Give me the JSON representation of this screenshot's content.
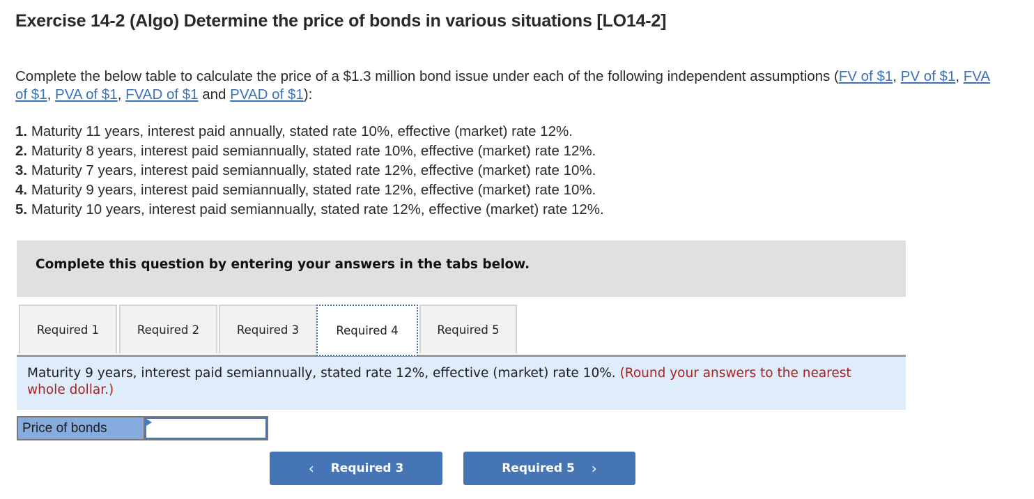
{
  "title": "Exercise 14-2 (Algo) Determine the price of bonds in various situations [LO14-2]",
  "intro": {
    "text_before": "Complete the below table to calculate the price of a $1.3 million bond issue under each of the following independent assumptions (",
    "links": [
      "FV of $1",
      "PV of $1",
      "FVA of $1",
      "PVA of $1",
      "FVAD of $1",
      "PVAD of $1"
    ],
    "separator": ", ",
    "conjunction": " and ",
    "text_after": "):"
  },
  "assumptions": [
    {
      "num": "1.",
      "text": "Maturity 11 years, interest paid annually, stated rate 10%, effective (market) rate 12%."
    },
    {
      "num": "2.",
      "text": "Maturity 8 years, interest paid semiannually, stated rate 10%, effective (market) rate 12%."
    },
    {
      "num": "3.",
      "text": "Maturity 7 years, interest paid semiannually, stated rate 12%, effective (market) rate 10%."
    },
    {
      "num": "4.",
      "text": "Maturity 9 years, interest paid semiannually, stated rate 12%, effective (market) rate 10%."
    },
    {
      "num": "5.",
      "text": "Maturity 10 years, interest paid semiannually, stated rate 12%, effective (market) rate 12%."
    }
  ],
  "instruction": "Complete this question by entering your answers in the tabs below.",
  "tabs": [
    {
      "label": "Required 1",
      "active": false
    },
    {
      "label": "Required 2",
      "active": false
    },
    {
      "label": "Required 3",
      "active": false
    },
    {
      "label": "Required 4",
      "active": true
    },
    {
      "label": "Required 5",
      "active": false
    }
  ],
  "prompt": {
    "text": "Maturity 9 years, interest paid semiannually, stated rate 12%, effective (market) rate 10%.",
    "note": "(Round your answers to the nearest whole dollar.)"
  },
  "answer": {
    "label": "Price of bonds",
    "value": "",
    "placeholder": ""
  },
  "navigation": {
    "prev_label": "Required 3",
    "next_label": "Required 5",
    "prev_icon": "chevron-left-icon",
    "next_icon": "chevron-right-icon"
  },
  "colors": {
    "link": "#3b73b9",
    "button": "#4575b4",
    "note_red": "#a81f1f",
    "panel_blue": "#deedf9",
    "label_blue": "#86acdf"
  }
}
